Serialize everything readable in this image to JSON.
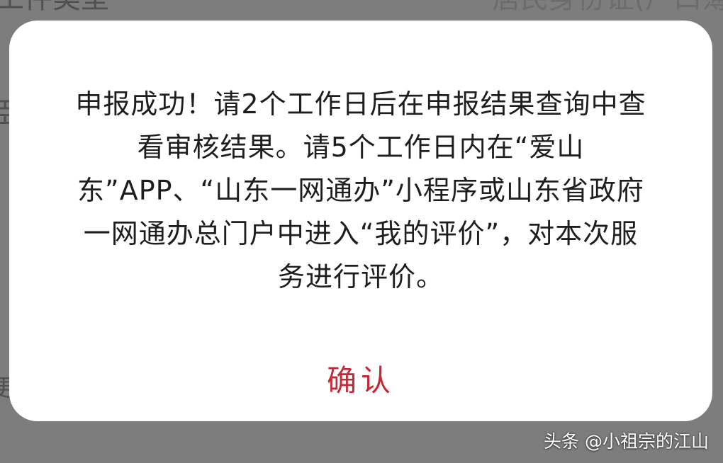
{
  "background": {
    "top_left": "工件类型",
    "top_right": "居民身份证(户口簿"
  },
  "dialog": {
    "message": "申报成功！请2个工作日后在申报结果查询中查看审核结果。请5个工作日内在“爱山东”APP、“山东一网通办”小程序或山东省政府一网通办总门户中进入“我的评价”，对本次服务进行评价。",
    "confirm_label": "确认"
  },
  "watermark": {
    "text": "头条 @小祖宗的江山"
  },
  "colors": {
    "overlay": "#7d7d7d",
    "dialog_background": "#ffffff",
    "message_text": "#1e1e1e",
    "confirm_text": "#c42a35"
  }
}
